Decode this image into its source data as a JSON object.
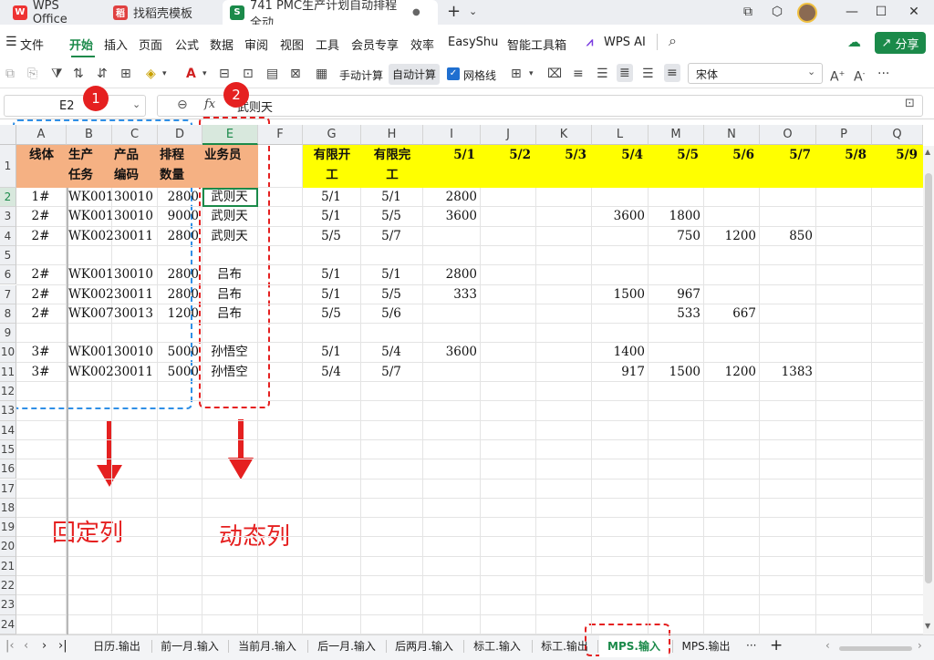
{
  "tabs": {
    "wps_office": "WPS Office",
    "template": "找稻壳模板",
    "file": "741 PMC生产计划自动排程全动",
    "new_tab": "+"
  },
  "menu": {
    "file": "文件",
    "home": "开始",
    "insert": "插入",
    "page": "页面",
    "formula": "公式",
    "data": "数据",
    "review": "审阅",
    "view": "视图",
    "tools": "工具",
    "member": "会员专享",
    "efficiency": "效率",
    "easyshu": "EasyShu",
    "smart": "智能工具箱",
    "wps_ai": "WPS AI",
    "share": "分享"
  },
  "toolbar": {
    "manual_calc": "手动计算",
    "auto_calc": "自动计算",
    "gridlines": "网格线",
    "font_name": "宋体"
  },
  "formula_bar": {
    "cell_ref": "E2",
    "fx": "fx",
    "value": "武则天"
  },
  "columns": [
    "A",
    "B",
    "C",
    "D",
    "E",
    "F",
    "G",
    "H",
    "I",
    "J",
    "K",
    "L",
    "M",
    "N",
    "O",
    "P",
    "Q"
  ],
  "rows": [
    "1",
    "2",
    "3",
    "4",
    "5",
    "6",
    "7",
    "8",
    "9",
    "10",
    "11",
    "12",
    "13",
    "14",
    "15",
    "16",
    "17",
    "18",
    "19",
    "20",
    "21",
    "22",
    "23",
    "24"
  ],
  "header_row": {
    "a": [
      "线体"
    ],
    "b": [
      "生产",
      "任务"
    ],
    "c": [
      "产品",
      "编码"
    ],
    "d": [
      "排程",
      "数量"
    ],
    "e": [
      "业务员"
    ],
    "g": [
      "有限开",
      "工"
    ],
    "h": [
      "有限完",
      "工"
    ],
    "dates": [
      "5/1",
      "5/2",
      "5/3",
      "5/4",
      "5/5",
      "5/6",
      "5/7",
      "5/8",
      "5/9"
    ]
  },
  "data_rows": [
    {
      "a": "1#",
      "b": "WK001",
      "c": "30010",
      "d": "2800",
      "e": "武则天",
      "g": "5/1",
      "h": "5/1",
      "i": "2800",
      "l": "",
      "m": "",
      "n": "",
      "o": ""
    },
    {
      "a": "2#",
      "b": "WK001",
      "c": "30010",
      "d": "9000",
      "e": "武则天",
      "g": "5/1",
      "h": "5/5",
      "i": "3600",
      "l": "3600",
      "m": "1800",
      "n": "",
      "o": ""
    },
    {
      "a": "2#",
      "b": "WK002",
      "c": "30011",
      "d": "2800",
      "e": "武则天",
      "g": "5/5",
      "h": "5/7",
      "i": "",
      "l": "",
      "m": "750",
      "n": "1200",
      "o": "850"
    },
    {
      "a": "",
      "b": "",
      "c": "",
      "d": "",
      "e": "",
      "g": "",
      "h": "",
      "i": "",
      "l": "",
      "m": "",
      "n": "",
      "o": ""
    },
    {
      "a": "2#",
      "b": "WK001",
      "c": "30010",
      "d": "2800",
      "e": "吕布",
      "g": "5/1",
      "h": "5/1",
      "i": "2800",
      "l": "",
      "m": "",
      "n": "",
      "o": ""
    },
    {
      "a": "2#",
      "b": "WK002",
      "c": "30011",
      "d": "2800",
      "e": "吕布",
      "g": "5/1",
      "h": "5/5",
      "i": "333",
      "l": "1500",
      "m": "967",
      "n": "",
      "o": ""
    },
    {
      "a": "2#",
      "b": "WK007",
      "c": "30013",
      "d": "1200",
      "e": "吕布",
      "g": "5/5",
      "h": "5/6",
      "i": "",
      "l": "",
      "m": "533",
      "n": "667",
      "o": ""
    },
    {
      "a": "",
      "b": "",
      "c": "",
      "d": "",
      "e": "",
      "g": "",
      "h": "",
      "i": "",
      "l": "",
      "m": "",
      "n": "",
      "o": ""
    },
    {
      "a": "3#",
      "b": "WK001",
      "c": "30010",
      "d": "5000",
      "e": "孙悟空",
      "g": "5/1",
      "h": "5/4",
      "i": "3600",
      "l": "1400",
      "m": "",
      "n": "",
      "o": ""
    },
    {
      "a": "3#",
      "b": "WK002",
      "c": "30011",
      "d": "5000",
      "e": "孙悟空",
      "g": "5/4",
      "h": "5/7",
      "i": "",
      "l": "917",
      "m": "1500",
      "n": "1200",
      "o": "1383"
    }
  ],
  "annotations": {
    "badge1": "1",
    "badge2": "2",
    "fixed_label": "回定列",
    "dynamic_label": "动态列"
  },
  "sheet_tabs": [
    "日历.输出",
    "前一月.输入",
    "当前月.输入",
    "后一月.输入",
    "后两月.输入",
    "标工.输入",
    "标工.输出",
    "MPS.输入",
    "MPS.输出"
  ],
  "sheet_more": "···",
  "sheet_add": "+",
  "colors": {
    "header_orange": "#f5b183",
    "header_yellow": "#ffff00",
    "accent_green": "#1b8a4a",
    "annot_blue": "#2f8fe6",
    "annot_red": "#e52020"
  }
}
